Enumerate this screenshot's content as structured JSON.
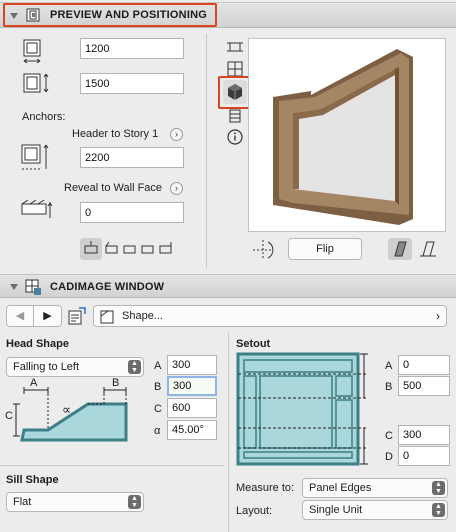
{
  "preview": {
    "title": "PREVIEW AND POSITIONING",
    "width_value": "1200",
    "height_value": "1500",
    "anchors_label": "Anchors:",
    "header_anchor_label": "Header to Story 1",
    "header_value": "2200",
    "reveal_label": "Reveal to Wall Face",
    "reveal_value": "0",
    "flip_label": "Flip"
  },
  "cadimage": {
    "title": "CADIMAGE WINDOW",
    "nav_value": "Shape...",
    "head_shape": {
      "title": "Head Shape",
      "select_value": "Falling to Left",
      "fields": [
        {
          "letter": "A",
          "value": "300"
        },
        {
          "letter": "B",
          "value": "300"
        },
        {
          "letter": "C",
          "value": "600"
        },
        {
          "letter": "α",
          "value": "45.00°"
        }
      ],
      "diagram_labels": {
        "a": "A",
        "b": "B",
        "c": "C",
        "angle": "∝"
      }
    },
    "setout": {
      "title": "Setout",
      "fields": [
        {
          "letter": "A",
          "value": "0"
        },
        {
          "letter": "B",
          "value": "500"
        },
        {
          "letter": "C",
          "value": "300"
        },
        {
          "letter": "D",
          "value": "0"
        }
      ]
    },
    "sill_shape": {
      "title": "Sill Shape",
      "select_value": "Flat"
    },
    "measure_to": {
      "label": "Measure to:",
      "value": "Panel Edges"
    },
    "layout": {
      "label": "Layout:",
      "value": "Single Unit"
    }
  },
  "colors": {
    "highlight": "#d9451f",
    "window_fill": "#a9d7dc",
    "window_frame": "#3d7f86",
    "frame_wood": "#9c7f5e"
  }
}
